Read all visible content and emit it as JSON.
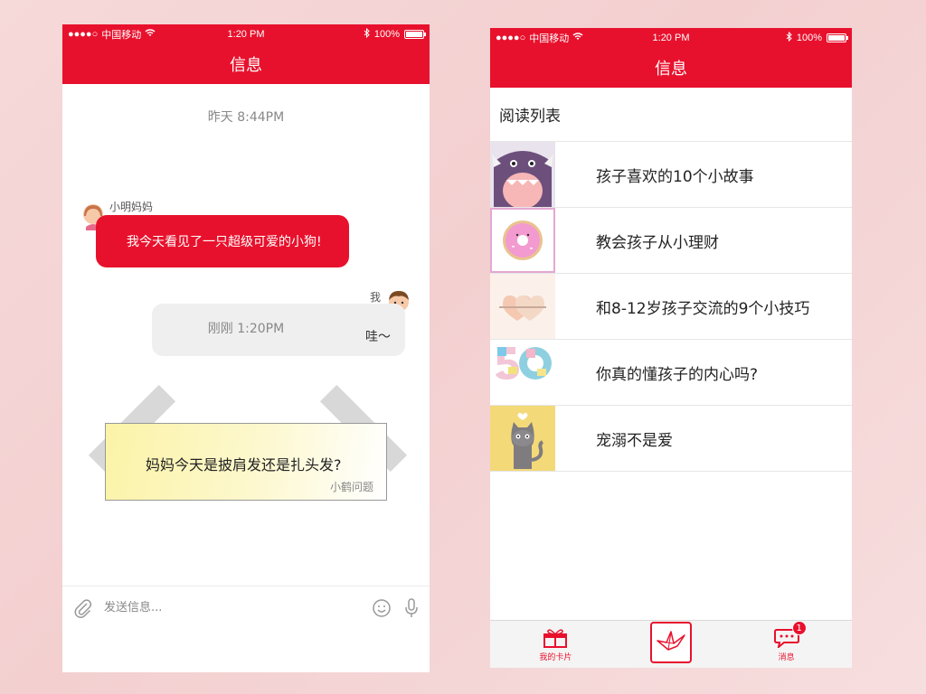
{
  "status_bar": {
    "carrier": "中国移动",
    "time": "1:20 PM",
    "battery": "100%",
    "battery_level": 1.0
  },
  "left_screen": {
    "title": "信息",
    "messages": [
      {
        "timestamp": "昨天 8:44PM"
      },
      {
        "sender": "小明妈妈",
        "text": "我今天看见了一只超级可爱的小狗!"
      },
      {
        "sender": "我",
        "text": "哇～"
      },
      {
        "timestamp": "刚刚 1:20PM"
      }
    ],
    "note": {
      "text": "妈妈今天是披肩发还是扎头发?",
      "signature": "小鹤问题"
    },
    "composer": {
      "placeholder": "发送信息..."
    }
  },
  "right_screen": {
    "title": "信息",
    "section_title": "阅读列表",
    "items": [
      {
        "title": "孩子喜欢的10个小故事",
        "thumb": "monster-thumbnail"
      },
      {
        "title": "教会孩子从小理财",
        "thumb": "donut-thumbnail"
      },
      {
        "title": "和8-12岁孩子交流的9个小技巧",
        "thumb": "hearts-thumbnail"
      },
      {
        "title": "你真的懂孩子的内心吗?",
        "thumb": "number-50-thumbnail"
      },
      {
        "title": "宠溺不是爱",
        "thumb": "cat-thumbnail"
      }
    ],
    "tabs": {
      "cards": "我的卡片",
      "messages": "消息",
      "badge_count": "1"
    }
  },
  "colors": {
    "primary_red": "#e8112d",
    "bubble_grey": "#efefef",
    "note_yellow": "#fbf3a7"
  }
}
